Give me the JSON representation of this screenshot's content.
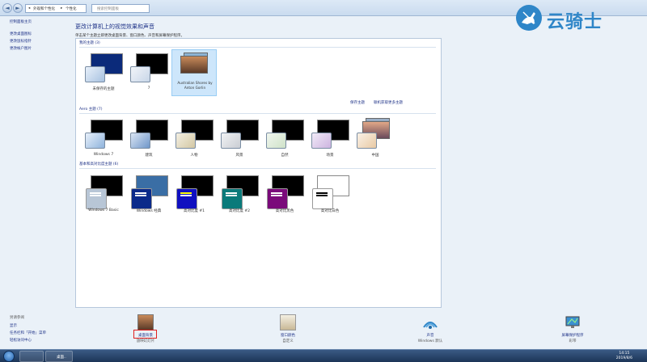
{
  "address": {
    "back_glyph": "◄",
    "forward_glyph": "►",
    "crumb_root": "◂",
    "crumb_parent": "外观和个性化",
    "crumb_sep": "▸",
    "crumb_current": "个性化",
    "search_placeholder": "搜索控制面板"
  },
  "sidebar": {
    "home": "控制面板主页",
    "links": [
      "更改桌面图标",
      "更改鼠标指针",
      "更改帐户图片"
    ],
    "see_also_title": "另请参阅",
    "see_also": [
      "显示",
      "任务栏和「开始」菜单",
      "轻松访问中心"
    ]
  },
  "main": {
    "title": "更改计算机上的视觉效果和声音",
    "subtitle": "单击某个主题立即更改桌面背景、窗口颜色、声音和屏幕保护程序。",
    "my_themes_header": "我的主题 (3)",
    "save_theme_link": "保存主题",
    "online_link": "联机获取更多主题",
    "aero_header": "Aero 主题 (7)",
    "basic_header": "基本和高对比度主题 (6)",
    "my_themes": [
      {
        "name": "未保存的主题",
        "thumb": "#0b2a7a",
        "win": "#a8c2e0"
      },
      {
        "name": "7",
        "thumb": "#000000",
        "win": "#c8d6e8"
      },
      {
        "name": "Australian Shores by Anton Gorlin",
        "thumb": "#7a5a3a",
        "selected": true
      }
    ],
    "aero_themes": [
      {
        "name": "Windows 7",
        "win": "#8fb3dc"
      },
      {
        "name": "建筑",
        "win": "#6f96c9"
      },
      {
        "name": "人物",
        "win": "#d3c7a3"
      },
      {
        "name": "风景",
        "win": "#c9cdd3"
      },
      {
        "name": "自然",
        "win": "#cfe2c8"
      },
      {
        "name": "场景",
        "win": "#cdb4e0"
      },
      {
        "name": "中国",
        "win": "#e8c9a4"
      }
    ],
    "basic_themes": [
      {
        "name": "Windows 7 Basic",
        "thumb": "#000000",
        "palette": "#b8c6d6",
        "bar": "#ffffff"
      },
      {
        "name": "Windows 经典",
        "thumb": "#3a6ea5",
        "palette": "#0a2a8a",
        "bar": "#ffffff"
      },
      {
        "name": "高对比度 #1",
        "thumb": "#000000",
        "palette": "#1010c0",
        "bar": "#ffff00"
      },
      {
        "name": "高对比度 #2",
        "thumb": "#000000",
        "palette": "#0a7a7a",
        "bar": "#ffffff"
      },
      {
        "name": "高对比黑色",
        "thumb": "#000000",
        "palette": "#7a0a7a",
        "bar": "#ffffff"
      },
      {
        "name": "高对比白色",
        "thumb": "#ffffff",
        "palette": "#ffffff",
        "bar": "#000000"
      }
    ]
  },
  "bottom": [
    {
      "label": "桌面背景",
      "sub": "放映幻灯片"
    },
    {
      "label": "窗口颜色",
      "sub": "自定义"
    },
    {
      "label": "声音",
      "sub": "Windows 默认"
    },
    {
      "label": "屏幕保护程序",
      "sub": "彩带"
    }
  ],
  "taskbar": {
    "btn1": "",
    "btn2": "桌面..",
    "time": "14:15",
    "date": "2019/8/6"
  },
  "watermark": "云骑士"
}
